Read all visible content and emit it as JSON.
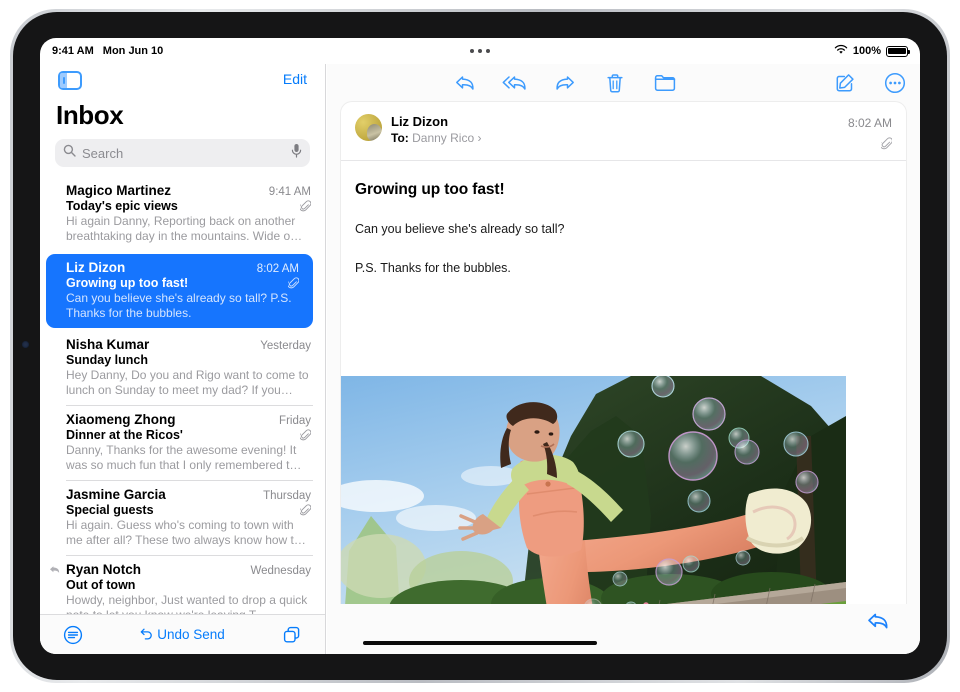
{
  "status_bar": {
    "time": "9:41 AM",
    "date": "Mon Jun 10",
    "battery_percent": "100%",
    "wifi_icon": "wifi-icon",
    "battery_icon": "battery-icon",
    "multitask_icon": "multitasking-dots-icon"
  },
  "list_pane": {
    "sidebar_toggle_icon": "sidebar-toggle-icon",
    "edit_label": "Edit",
    "title": "Inbox",
    "search": {
      "placeholder": "Search",
      "search_icon": "search-icon",
      "dictate_icon": "microphone-icon"
    },
    "messages": [
      {
        "sender": "Magico Martinez",
        "date": "9:41 AM",
        "subject": "Today's epic views",
        "preview": "Hi again Danny, Reporting back on another breathtaking day in the mountains. Wide o…",
        "attachment": true,
        "replied": false,
        "selected": false
      },
      {
        "sender": "Liz Dizon",
        "date": "8:02 AM",
        "subject": "Growing up too fast!",
        "preview": "Can you believe she's already so tall? P.S. Thanks for the bubbles.",
        "attachment": true,
        "replied": false,
        "selected": true
      },
      {
        "sender": "Nisha Kumar",
        "date": "Yesterday",
        "subject": "Sunday lunch",
        "preview": "Hey Danny, Do you and Rigo want to come to lunch on Sunday to meet my dad? If you…",
        "attachment": false,
        "replied": false,
        "selected": false
      },
      {
        "sender": "Xiaomeng Zhong",
        "date": "Friday",
        "subject": "Dinner at the Ricos'",
        "preview": "Danny, Thanks for the awesome evening! It was so much fun that I only remembered t…",
        "attachment": true,
        "replied": false,
        "selected": false
      },
      {
        "sender": "Jasmine Garcia",
        "date": "Thursday",
        "subject": "Special guests",
        "preview": "Hi again. Guess who's coming to town with me after all? These two always know how t…",
        "attachment": true,
        "replied": false,
        "selected": false
      },
      {
        "sender": "Ryan Notch",
        "date": "Wednesday",
        "subject": "Out of town",
        "preview": "Howdy, neighbor, Just wanted to drop a quick note to let you know we're leaving T…",
        "attachment": false,
        "replied": true,
        "selected": false
      }
    ],
    "toolbar": {
      "filter_icon": "filter-icon",
      "undo_send_label": "Undo Send",
      "undo_icon": "undo-arrow-icon",
      "new_window_icon": "duplicate-window-icon"
    }
  },
  "detail_pane": {
    "toolbar": {
      "reply_icon": "reply-arrow-icon",
      "reply_all_icon": "reply-all-arrow-icon",
      "forward_icon": "forward-arrow-icon",
      "trash_icon": "trash-icon",
      "folder_icon": "folder-icon",
      "compose_icon": "compose-pencil-icon",
      "more_icon": "more-ellipsis-circle-icon"
    },
    "message": {
      "avatar_icon": "sender-avatar",
      "from_name": "Liz Dizon",
      "to_label": "To:",
      "to_name": "Danny Rico",
      "to_chevron": "chevron-right-icon",
      "time": "8:02 AM",
      "attachment_icon": "paperclip-icon",
      "subject": "Growing up too fast!",
      "paragraphs": [
        "Can you believe she's already so tall?",
        "P.S. Thanks for the bubbles."
      ],
      "photo_alt": "Girl in peach overalls kicking in a yard with soap bubbles"
    },
    "bottom": {
      "reply_icon": "reply-arrow-icon"
    }
  },
  "colors": {
    "accent_blue": "#067cfb",
    "selection_blue": "#1675fe",
    "muted_gray": "#9b9b9f"
  }
}
